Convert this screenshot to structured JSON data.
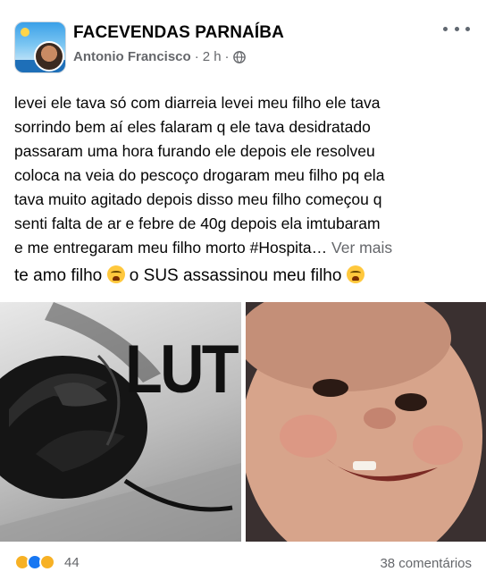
{
  "header": {
    "group_name": "FACEVENDAS PARNAÍBA",
    "author": "Antonio Francisco",
    "time": "2 h",
    "separator": "·"
  },
  "post": {
    "lines": [
      "levei ele tava só com diarreia levei meu filho ele tava",
      "sorrindo bem aí eles falaram q ele tava desidratado",
      "passaram uma hora furando ele depois ele resolveu",
      "coloca na veia do pescoço drogaram meu filho pq ela",
      "tava muito agitado depois disso meu filho começou q",
      "senti falta de ar e febre de 40g  depois ela imtubaram",
      "e me entregaram meu filho morto #Hospita…"
    ],
    "see_more": "Ver mais",
    "caption_part1": "te amo filho",
    "caption_part2": "o SUS assassinou meu filho"
  },
  "media": {
    "left_image_text": "LUT"
  },
  "footer": {
    "reaction_count": "44",
    "comments": "38 comentários"
  },
  "colors": {
    "text": "#050505",
    "secondary": "#65676b"
  },
  "icons": [
    "globe-icon",
    "more-options-icon",
    "crying-face-emoji",
    "black-rose",
    "like-reaction-icon",
    "love-reaction-icon",
    "care-reaction-icon"
  ]
}
